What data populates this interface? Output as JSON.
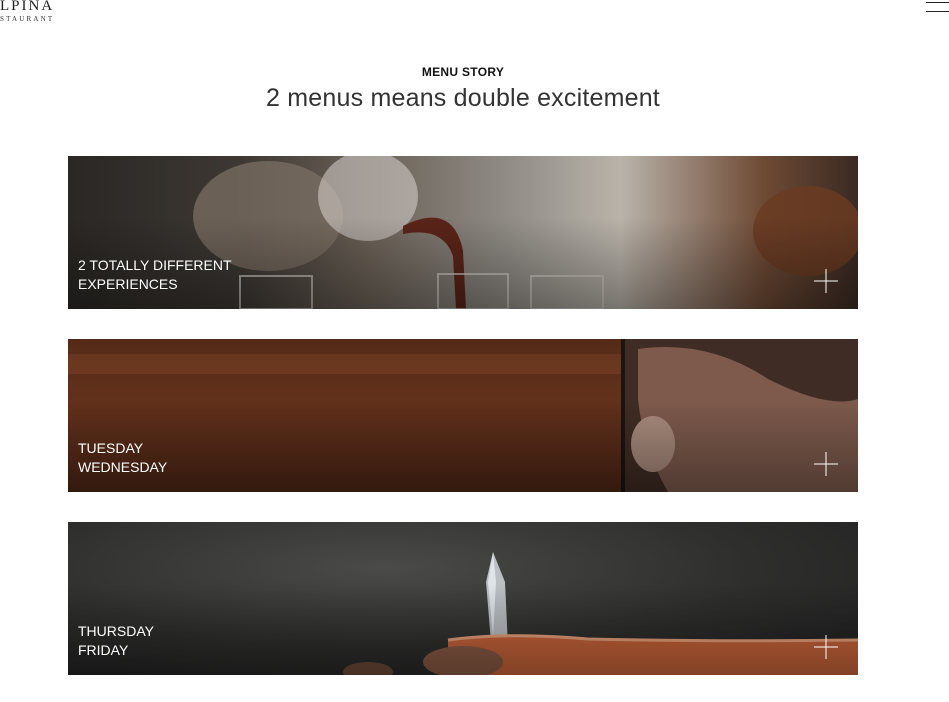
{
  "header": {
    "logo_name": "LPINA",
    "logo_sub": "STAURANT"
  },
  "intro": {
    "eyebrow": "MENU STORY",
    "headline": "2 menus means double excitement"
  },
  "cards": [
    {
      "line1": "2 TOTALLY DIFFERENT",
      "line2": "EXPERIENCES"
    },
    {
      "line1": "TUESDAY",
      "line2": "WEDNESDAY"
    },
    {
      "line1": "THURSDAY",
      "line2": "FRIDAY"
    }
  ]
}
